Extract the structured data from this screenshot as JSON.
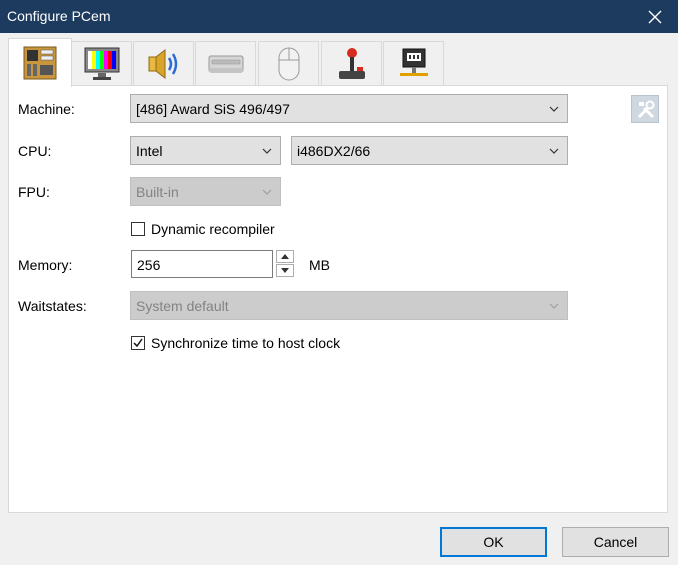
{
  "window": {
    "title": "Configure PCem"
  },
  "tabs": [
    {
      "name": "machine-tab",
      "icon": "motherboard-icon"
    },
    {
      "name": "display-tab",
      "icon": "monitor-icon"
    },
    {
      "name": "sound-tab",
      "icon": "speaker-icon"
    },
    {
      "name": "storage-tab",
      "icon": "drive-icon"
    },
    {
      "name": "mouse-tab",
      "icon": "mouse-icon"
    },
    {
      "name": "joystick-tab",
      "icon": "joystick-icon"
    },
    {
      "name": "network-tab",
      "icon": "network-icon"
    }
  ],
  "machine": {
    "machine_label": "Machine:",
    "machine_value": "[486] Award SiS 496/497",
    "cpu_label": "CPU:",
    "cpu_vendor": "Intel",
    "cpu_model": "i486DX2/66",
    "fpu_label": "FPU:",
    "fpu_value": "Built-in",
    "dynarec_label": "Dynamic recompiler",
    "dynarec_checked": false,
    "memory_label": "Memory:",
    "memory_value": "256",
    "memory_unit": "MB",
    "waitstates_label": "Waitstates:",
    "waitstates_value": "System default",
    "sync_label": "Synchronize time to host clock",
    "sync_checked": true
  },
  "buttons": {
    "ok": "OK",
    "cancel": "Cancel"
  },
  "colors": {
    "titlebar": "#1d3b5f",
    "accent": "#0078d7"
  }
}
